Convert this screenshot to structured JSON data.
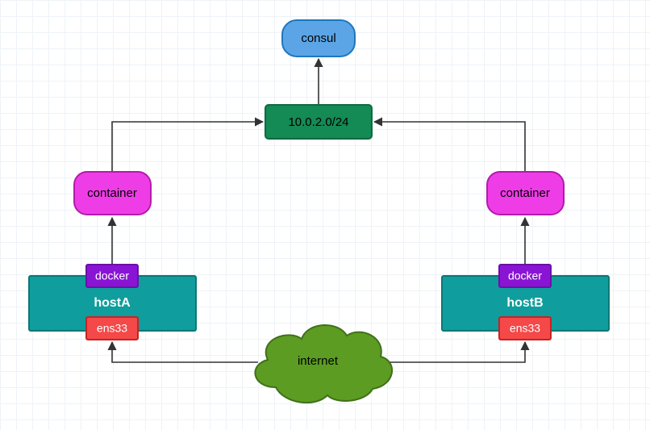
{
  "consul_label": "consul",
  "subnet_label": "10.0.2.0/24",
  "container_a_label": "container",
  "container_b_label": "container",
  "host_a": {
    "docker_label": "docker",
    "name": "hostA",
    "ens33_label": "ens33"
  },
  "host_b": {
    "docker_label": "docker",
    "name": "hostB",
    "ens33_label": "ens33"
  },
  "internet_label": "internet",
  "colors": {
    "consul_fill": "#5ba5e6",
    "consul_stroke": "#1e77bf",
    "subnet_fill": "#148a55",
    "subnet_stroke": "#0d6a41",
    "container_fill": "#ee3de6",
    "container_stroke": "#b21caa",
    "host_fill": "#109d9d",
    "host_stroke": "#0b7777",
    "docker_fill": "#8a14d4",
    "docker_stroke": "#6b0fa7",
    "ens33_fill": "#f54848",
    "ens33_stroke": "#c22424",
    "internet_fill": "#5c9c22",
    "internet_stroke": "#40701a",
    "arrow": "#333333"
  }
}
